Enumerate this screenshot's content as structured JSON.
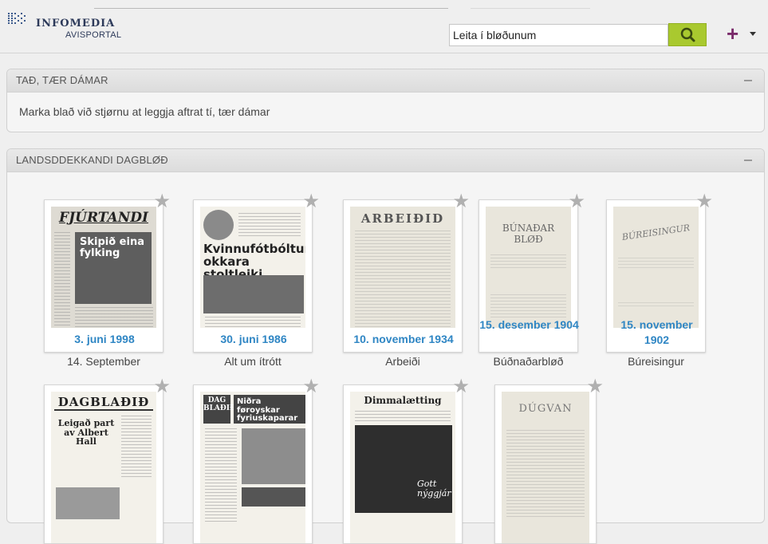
{
  "header": {
    "logo_title": "INFOMEDIA",
    "logo_subtitle": "AVISPORTAL",
    "search_value": "Leita í bløðunum",
    "plus_label": "+"
  },
  "favorites_panel": {
    "title": "TAÐ, TÆR DÁMAR",
    "message": "Marka blað við stjørnu at leggja aftrat tí, tær dámar"
  },
  "papers_panel": {
    "title": "LANDSDDEKKANDI DAGBLØÐ",
    "papers": [
      {
        "date": "3. juni 1998",
        "name": "14. September",
        "masthead": "FJÚRTANDI",
        "headline": "Skipið eina fylking"
      },
      {
        "date": "30. juni 1986",
        "name": "Alt um ítrótt",
        "masthead": "",
        "headline": "Kvinnufótbóltur okkara stoltleiki"
      },
      {
        "date": "10. november 1934",
        "name": "Arbeiði",
        "masthead": "ARBEIÐID",
        "headline": ""
      },
      {
        "date": "15. desember 1904",
        "name": "Búðnaðarbløð",
        "masthead": "BÚNAÐAR BLØÐ",
        "headline": ""
      },
      {
        "date": "15. november 1902",
        "name": "Búreisingur",
        "masthead": "BÚREISINGUR",
        "headline": ""
      },
      {
        "date": "",
        "name": "",
        "masthead": "DAGBLAÐIÐ",
        "headline": "Leigað part av Albert Hall"
      },
      {
        "date": "",
        "name": "",
        "masthead": "DAG BLAÐIÐ",
        "headline": "Niðra føroyskar fyriuskaparar"
      },
      {
        "date": "",
        "name": "",
        "masthead": "Dimmalætting",
        "headline": "Gott nýggjár"
      },
      {
        "date": "",
        "name": "",
        "masthead": "DÚGVAN",
        "headline": ""
      }
    ]
  },
  "colors": {
    "accent_blue": "#2f86c4",
    "search_green": "#a9c92f",
    "plus_purple": "#7a2c6b"
  },
  "icons": [
    "search-icon",
    "plus-icon",
    "chevron-down-icon",
    "star-icon",
    "collapse-icon"
  ]
}
